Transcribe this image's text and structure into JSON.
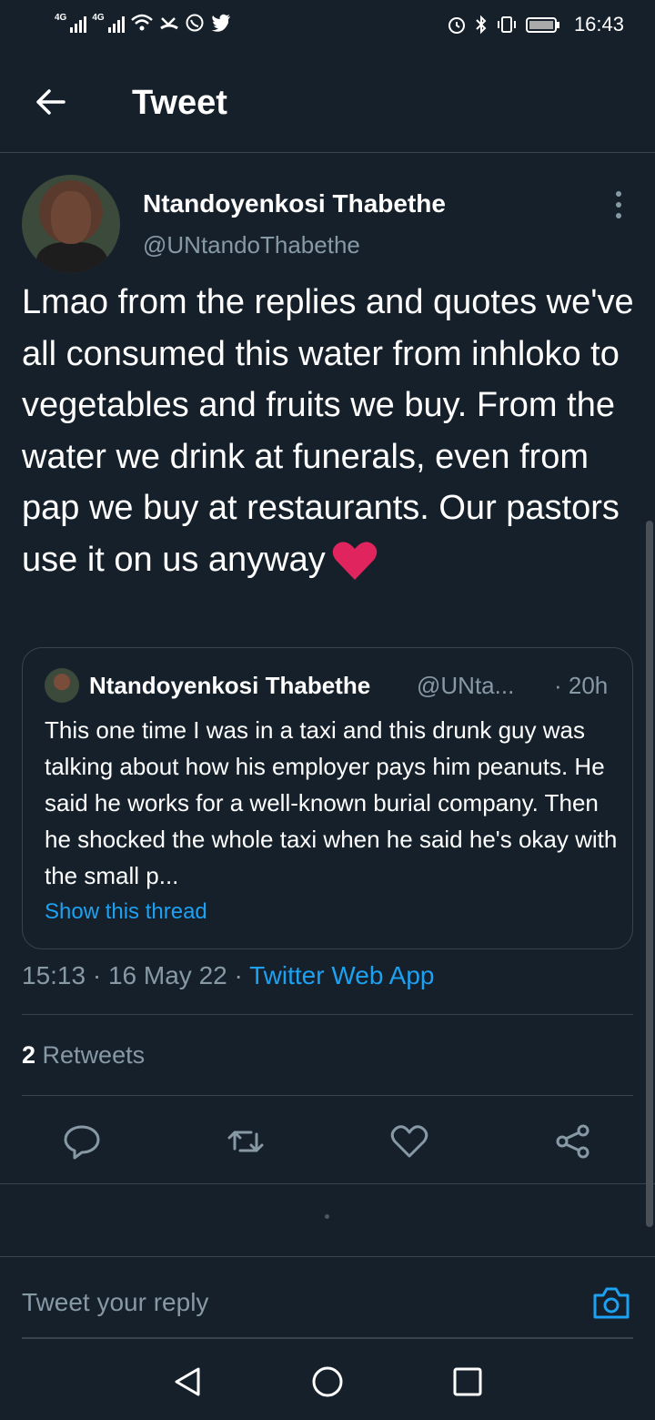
{
  "status_bar": {
    "net1": "4G",
    "net2": "4G",
    "time": "16:43"
  },
  "header": {
    "title": "Tweet"
  },
  "tweet": {
    "author_name": "Ntandoyenkosi Thabethe",
    "author_handle": "@UNtandoThabethe",
    "text": "Lmao from the replies and quotes we've all consumed this water from inhloko to vegetables and fruits we buy. From the water we drink at funerals, even from pap we buy at restaurants. Our pastors use it on us anyway",
    "emoji": "red-heart",
    "time": "15:13",
    "date": "16 May 22",
    "source": "Twitter Web App",
    "retweets_count": "2",
    "retweets_label": "Retweets"
  },
  "quoted": {
    "author_name": "Ntandoyenkosi Thabethe",
    "author_handle": "@UNta...",
    "age": "· 20h",
    "text": "This one time I was in a taxi and this drunk guy was talking about how his employer pays him peanuts. He said he works for a well-known burial company. Then he shocked the whole taxi when he said he's okay with the small p...",
    "link": "Show this thread"
  },
  "actions": [
    "reply-icon",
    "retweet-icon",
    "like-icon",
    "share-icon"
  ],
  "reply": {
    "placeholder": "Tweet your reply"
  },
  "colors": {
    "background": "#15202b",
    "accent": "#1da1f2",
    "secondary_text": "#8899a6",
    "divider": "#38444d",
    "heart": "#e0245e"
  }
}
